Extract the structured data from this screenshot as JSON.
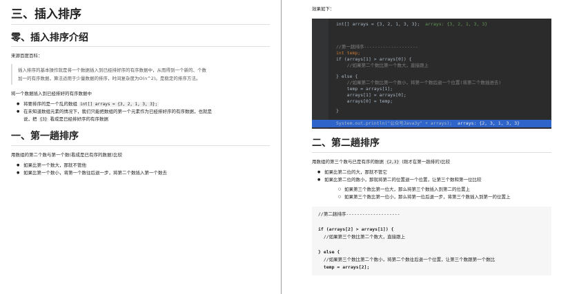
{
  "left": {
    "title": "三、插入排序",
    "intro_heading": "零、插入排序介绍",
    "source": "来源百度百科：",
    "quote_line1": "插入排序的基本操作就是将一个数据插入到已经排好序的有序数据中，从而得到一个新的、个数",
    "quote_line2": "加一的有序数据，算法适用于少量数据的排序，时间复杂度为O(n^2)。是稳定的排序方法。",
    "subhead": "将一个数据插入到已经排好的有序数据中",
    "bullet1_pre": "将要排序的是一个乱的数组 ",
    "bullet1_code": "int[] arrays = {3, 2, 1, 3, 3};",
    "bullet2_line1": "在未知道数组元素的情况下，我们只能把数组的第一个元素作为已经排好序的有序数据，也就是",
    "bullet2_line2_pre": "说，把 ",
    "bullet2_code": "{3}",
    "bullet2_line2_post": " 看成是已经排好序的有序数据",
    "pass1_heading": "一、第一趟排序",
    "pass1_desc": "用数组的第二个数与第一个数(看成是已有序的数据)比较",
    "pass1_b1": "如果比第一个数大，那就不管他",
    "pass1_b2": "如果比第一个数小，将第一个数往后退一步，将第二个数插入第一个数去"
  },
  "right": {
    "effect": "效果如下：",
    "code": {
      "l1a": "int[] arrays = {3, 2, 1, 3, 3};",
      "l1b": "arrays: {3, 2, 1, 3, 3}",
      "l2": "//第一趟排序--------------------",
      "l3": "int temp;",
      "l4a": "if (arrays[1] > arrays[0]) {",
      "l5": "    //如果第二个数比第一个数大，直接跟上",
      "l6": "} else {",
      "l7": "    //如果第二个数比第一个数小，将第一个数后退一个位置(将第二个数插进去)",
      "l8": "    temp = arrays[1];",
      "l9": "    arrays[1] = arrays[0];",
      "l10": "    arrays[0] = temp;",
      "l11": "}",
      "l12a": "System.out.println(\"公众号Java3y\" + arrays);",
      "l12b": "arrays: {2, 3, 1, 3, 3}"
    },
    "pass2_heading": "二、第二趟排序",
    "pass2_desc_pre": "用数组的第三个数与已是有序的数据 ",
    "pass2_desc_code": "{2,3}",
    "pass2_desc_post": " (刚才在第一趟排的)比较",
    "pass2_b1": "如果比第二位的大，那就不管它",
    "pass2_b2": "如果比第二位的数小，那就将第二的位置退一个位置，让第三个数和第一位比较",
    "pass2_sub1": "如果第三个数比第一位大，那么将第三个数插入到第二的位置上",
    "pass2_sub2": "如果第三个数比第一位小，那么将第一位后退一步，将第三个数插入到第一的位置上",
    "lcode": {
      "l1": "//第二趟排序--------------------",
      "l2": "if (arrays[2] > arrays[1]) {",
      "l3": "  //如果第三个数比第二个数大，直接跟上",
      "l4": "} else {",
      "l5": "  //如果第三个数比第二个数小，将第二个数往后退一个位置，让第三个数跟第一个数比",
      "l6": "  temp = arrays[2];"
    }
  }
}
